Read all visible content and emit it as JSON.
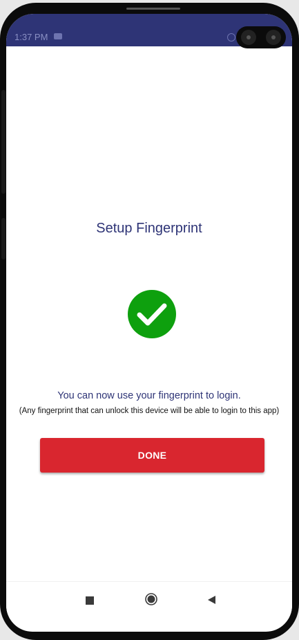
{
  "status_bar": {
    "time": "1:37 PM",
    "message_icon": "message-icon",
    "right_icon": "alarm-icon",
    "background_color": "#2e3476"
  },
  "screen": {
    "title": "Setup Fingerprint",
    "success_icon": "check-circle-icon",
    "success_color": "#0ea00e",
    "message": "You can now use your fingerprint to login.",
    "note": "(Any fingerprint that can unlock this device will be able to login to this app)",
    "done_label": "DONE",
    "done_color": "#d9262f"
  },
  "nav_bar": {
    "recents_icon": "square-icon",
    "home_icon": "circle-icon",
    "back_icon": "triangle-back-icon"
  }
}
